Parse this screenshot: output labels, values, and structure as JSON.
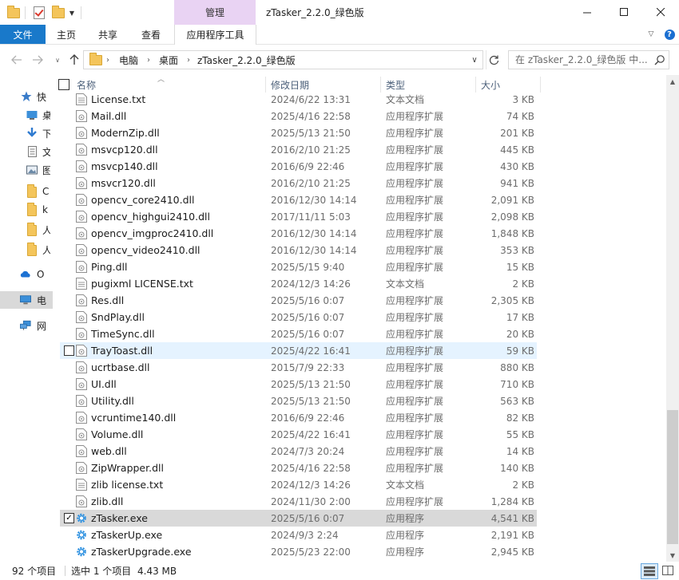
{
  "window": {
    "title": "zTasker_2.2.0_绿色版",
    "context_tab_group": "管理"
  },
  "ribbon": {
    "tabs": [
      "文件",
      "主页",
      "共享",
      "查看",
      "应用程序工具"
    ]
  },
  "address": {
    "crumbs": [
      "电脑",
      "桌面",
      "zTasker_2.2.0_绿色版"
    ],
    "search_placeholder": "在 zTasker_2.2.0_绿色版 中..."
  },
  "nav_pane": {
    "items": [
      {
        "label": "快",
        "icon": "star-icon"
      },
      {
        "label": "桌",
        "icon": "desktop-icon"
      },
      {
        "label": "下",
        "icon": "download-icon"
      },
      {
        "label": "文",
        "icon": "document-icon"
      },
      {
        "label": "图",
        "icon": "picture-icon"
      },
      {
        "label": "C",
        "icon": "folder-icon"
      },
      {
        "label": "k",
        "icon": "folder-icon"
      },
      {
        "label": "人",
        "icon": "folder-icon"
      },
      {
        "label": "人",
        "icon": "folder-icon"
      },
      {
        "label": "O",
        "icon": "cloud-icon"
      },
      {
        "label": "电",
        "icon": "computer-icon"
      },
      {
        "label": "网",
        "icon": "network-icon"
      }
    ]
  },
  "columns": {
    "name": "名称",
    "date": "修改日期",
    "type": "类型",
    "size": "大小"
  },
  "files": [
    {
      "name": "License.txt",
      "date": "2024/6/22 13:31",
      "type": "文本文档",
      "size": "3 KB",
      "kind": "txt"
    },
    {
      "name": "Mail.dll",
      "date": "2025/4/16 22:58",
      "type": "应用程序扩展",
      "size": "74 KB",
      "kind": "dll"
    },
    {
      "name": "ModernZip.dll",
      "date": "2025/5/13 21:50",
      "type": "应用程序扩展",
      "size": "201 KB",
      "kind": "dll"
    },
    {
      "name": "msvcp120.dll",
      "date": "2016/2/10 21:25",
      "type": "应用程序扩展",
      "size": "445 KB",
      "kind": "dll"
    },
    {
      "name": "msvcp140.dll",
      "date": "2016/6/9 22:46",
      "type": "应用程序扩展",
      "size": "430 KB",
      "kind": "dll"
    },
    {
      "name": "msvcr120.dll",
      "date": "2016/2/10 21:25",
      "type": "应用程序扩展",
      "size": "941 KB",
      "kind": "dll"
    },
    {
      "name": "opencv_core2410.dll",
      "date": "2016/12/30 14:14",
      "type": "应用程序扩展",
      "size": "2,091 KB",
      "kind": "dll"
    },
    {
      "name": "opencv_highgui2410.dll",
      "date": "2017/11/11 5:03",
      "type": "应用程序扩展",
      "size": "2,098 KB",
      "kind": "dll"
    },
    {
      "name": "opencv_imgproc2410.dll",
      "date": "2016/12/30 14:14",
      "type": "应用程序扩展",
      "size": "1,848 KB",
      "kind": "dll"
    },
    {
      "name": "opencv_video2410.dll",
      "date": "2016/12/30 14:14",
      "type": "应用程序扩展",
      "size": "353 KB",
      "kind": "dll"
    },
    {
      "name": "Ping.dll",
      "date": "2025/5/15 9:40",
      "type": "应用程序扩展",
      "size": "15 KB",
      "kind": "dll"
    },
    {
      "name": "pugixml LICENSE.txt",
      "date": "2024/12/3 14:26",
      "type": "文本文档",
      "size": "2 KB",
      "kind": "txt"
    },
    {
      "name": "Res.dll",
      "date": "2025/5/16 0:07",
      "type": "应用程序扩展",
      "size": "2,305 KB",
      "kind": "dll"
    },
    {
      "name": "SndPlay.dll",
      "date": "2025/5/16 0:07",
      "type": "应用程序扩展",
      "size": "17 KB",
      "kind": "dll"
    },
    {
      "name": "TimeSync.dll",
      "date": "2025/5/16 0:07",
      "type": "应用程序扩展",
      "size": "20 KB",
      "kind": "dll"
    },
    {
      "name": "TrayToast.dll",
      "date": "2025/4/22 16:41",
      "type": "应用程序扩展",
      "size": "59 KB",
      "kind": "dll",
      "state": "hover"
    },
    {
      "name": "ucrtbase.dll",
      "date": "2015/7/9 22:33",
      "type": "应用程序扩展",
      "size": "880 KB",
      "kind": "dll"
    },
    {
      "name": "UI.dll",
      "date": "2025/5/13 21:50",
      "type": "应用程序扩展",
      "size": "710 KB",
      "kind": "dll"
    },
    {
      "name": "Utility.dll",
      "date": "2025/5/13 21:50",
      "type": "应用程序扩展",
      "size": "563 KB",
      "kind": "dll"
    },
    {
      "name": "vcruntime140.dll",
      "date": "2016/6/9 22:46",
      "type": "应用程序扩展",
      "size": "82 KB",
      "kind": "dll"
    },
    {
      "name": "Volume.dll",
      "date": "2025/4/22 16:41",
      "type": "应用程序扩展",
      "size": "55 KB",
      "kind": "dll"
    },
    {
      "name": "web.dll",
      "date": "2024/7/3 20:24",
      "type": "应用程序扩展",
      "size": "14 KB",
      "kind": "dll"
    },
    {
      "name": "ZipWrapper.dll",
      "date": "2025/4/16 22:58",
      "type": "应用程序扩展",
      "size": "140 KB",
      "kind": "dll"
    },
    {
      "name": "zlib license.txt",
      "date": "2024/12/3 14:26",
      "type": "文本文档",
      "size": "2 KB",
      "kind": "txt"
    },
    {
      "name": "zlib.dll",
      "date": "2024/11/30 2:00",
      "type": "应用程序扩展",
      "size": "1,284 KB",
      "kind": "dll"
    },
    {
      "name": "zTasker.exe",
      "date": "2025/5/16 0:07",
      "type": "应用程序",
      "size": "4,541 KB",
      "kind": "exe",
      "state": "selected"
    },
    {
      "name": "zTaskerUp.exe",
      "date": "2024/9/3 2:24",
      "type": "应用程序",
      "size": "2,191 KB",
      "kind": "exe"
    },
    {
      "name": "zTaskerUpgrade.exe",
      "date": "2025/5/23 22:00",
      "type": "应用程序",
      "size": "2,945 KB",
      "kind": "exe"
    }
  ],
  "status": {
    "item_count": "92 个项目",
    "selection": "选中 1 个项目",
    "selection_size": "4.43 MB"
  },
  "colors": {
    "file_tab": "#1979ca",
    "context_tab": "#e9d3f3",
    "hover_row": "#e5f3ff",
    "selected_row": "#d9d9d9",
    "app_icon": "#2a8fe0"
  }
}
